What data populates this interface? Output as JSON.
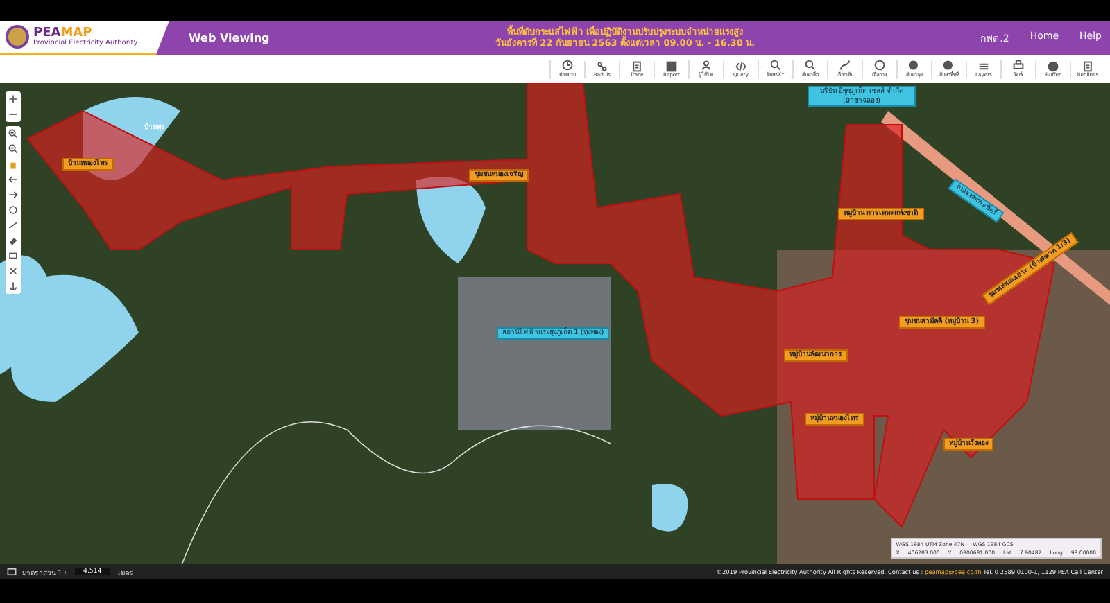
{
  "header": {
    "logo_brand_a": "PEA",
    "logo_brand_b": "MAP",
    "logo_subtitle": "Provincial Electricity Authority",
    "app_title": "Web Viewing",
    "notice_lines": [
      "พื้นที่ดับกระแสไฟฟ้า เพื่อปฏิบัติงานปรับปรุงระบบจำหน่ายแรงสูง",
      "วันอังคารที่ 22 กันยายน 2563 ตั้งแต่เวลา 09.00 น. - 16.30 น."
    ],
    "nav_links": [
      "กฟต.2",
      "Home",
      "Help"
    ]
  },
  "toolbar": [
    {
      "label": "ย่อขยาย"
    },
    {
      "label": "Raduis"
    },
    {
      "label": "Trace"
    },
    {
      "label": "Report"
    },
    {
      "label": "ผู้ใช้ไฟ"
    },
    {
      "label": "Query"
    },
    {
      "label": "ค้นหาXY"
    },
    {
      "label": "ค้นหาชื่อ"
    },
    {
      "label": "เลือกเส้น"
    },
    {
      "label": "เลือกวง"
    },
    {
      "label": "ค้นหาจุด"
    },
    {
      "label": "ค้นหาพื้นที่"
    },
    {
      "label": "Layers"
    },
    {
      "label": "พิมพ์"
    },
    {
      "label": "Buffer"
    },
    {
      "label": "Redlines"
    }
  ],
  "map": {
    "labels": [
      {
        "text": "บ้านหนองไทร",
        "kind": "area"
      },
      {
        "text": "บ้านทุ่ง",
        "kind": "place"
      },
      {
        "text": "ชุมชนหนองเจริญ",
        "kind": "area"
      },
      {
        "text": "สถานีไฟฟ้าแรงสูงภูเก็ต 1 (ทุ่งทอง)",
        "kind": "site"
      },
      {
        "text": "บริษัท อีซูซุภูเก็ต เซลส์ จำกัด (สาขาฉลอง)",
        "kind": "site"
      },
      {
        "text": "ถนนเทพกระษัตรี",
        "kind": "road"
      },
      {
        "text": "หมู่บ้าน การเคหะแห่งชาติ",
        "kind": "area"
      },
      {
        "text": "หมู่บ้านพัฒนาการ",
        "kind": "area"
      },
      {
        "text": "ชุมชนสามัคคี (หมู่บ้าน 3)",
        "kind": "area"
      },
      {
        "text": "ชุมชนหนองเยาะ (ข้างตลาด 1/3)",
        "kind": "area"
      },
      {
        "text": "หมู่บ้านหนองไทร",
        "kind": "area"
      },
      {
        "text": "หมู่บ้านวังทอง",
        "kind": "area"
      }
    ]
  },
  "coordinates": {
    "systems": [
      "WGS 1984 UTM Zone 47N",
      "WGS 1984 GCS"
    ],
    "fields": [
      {
        "label": "X",
        "value": "406283.000"
      },
      {
        "label": "Y",
        "value": "0800681.000"
      },
      {
        "label": "Lat",
        "value": "7.90482"
      },
      {
        "label": "Long",
        "value": "98.00000"
      }
    ]
  },
  "footer": {
    "scale_label": "มาตราส่วน 1 :",
    "scale_value": "4,514",
    "scale_unit": "เมตร",
    "copyright": "©2019 Provincial Electricity Authority All Rights Reserved. Contact us : ",
    "email": "peamap@pea.co.th",
    "phone": " Tel. 0 2589 0100-1, 1129 PEA Call Center"
  }
}
